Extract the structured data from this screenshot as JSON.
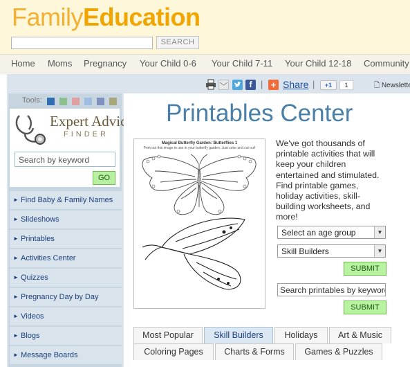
{
  "header": {
    "logo_part1": "Family",
    "logo_part2": "Education",
    "search_button": "SEARCH",
    "search_value": ""
  },
  "nav": {
    "items": [
      "Home",
      "Moms",
      "Pregnancy",
      "Your Child 0-6",
      "Your Child 7-11",
      "Your Child 12-18",
      "Community"
    ]
  },
  "sharebar": {
    "share_label": "Share",
    "plus_label": "+1",
    "plus_count": "1",
    "newsletter_label": "Newslette"
  },
  "sidebar": {
    "tools_label": "Tools:",
    "swatches": [
      "#2f6fb0",
      "#8bbf8b",
      "#e0a0a0",
      "#9fbde0",
      "#7f8fc0",
      "#a7a77a"
    ],
    "expert_title": "Expert Advice",
    "expert_subtitle": "FINDER",
    "keyword_placeholder": "Search by keyword",
    "go_label": "GO",
    "items": [
      "Find Baby & Family Names",
      "Slideshows",
      "Printables",
      "Activities Center",
      "Quizzes",
      "Pregnancy Day by Day",
      "Videos",
      "Blogs",
      "Message Boards"
    ]
  },
  "content": {
    "title": "Printables Center",
    "preview_title": "Magical Butterfly Garden: Butterflies 1",
    "preview_subtitle": "Print out this image to use in your butterfly garden. Just color and cut out!",
    "description": "We've got thousands of printable activities that will keep your children entertained and stimulated. Find printable games, holiday activities, skill-building worksheets, and more!",
    "age_select": "Select an age group",
    "skill_select": "Skill Builders",
    "submit_label": "SUBMIT",
    "search_placeholder": "Search printables by keyword",
    "tabs_row1": [
      "Most Popular",
      "Skill Builders",
      "Holidays",
      "Art & Music"
    ],
    "tabs_row2": [
      "Coloring Pages",
      "Charts & Forms",
      "Games & Puzzles"
    ],
    "active_tab": "Skill Builders"
  }
}
